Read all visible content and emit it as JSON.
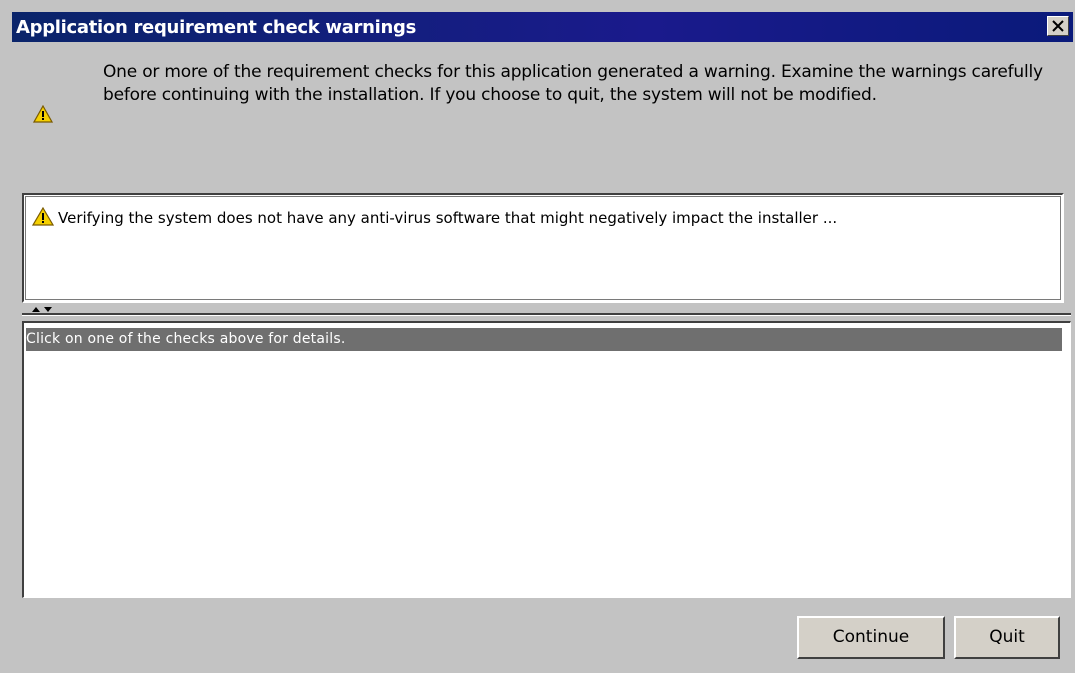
{
  "window": {
    "title": "Application requirement check warnings",
    "close_icon": "close-icon"
  },
  "header": {
    "message": "One or more of the requirement checks for this application generated a warning. Examine the warnings carefully before continuing with the installation. If you choose to quit, the system will not be modified.",
    "icon": "warning-icon"
  },
  "checks": [
    {
      "icon": "warning-icon",
      "label": "Verifying the system does not have any anti-virus software that might negatively impact the installer ..."
    }
  ],
  "details": {
    "header": "Click on one of the checks above for details."
  },
  "buttons": {
    "continue_label": "Continue",
    "quit_label": "Quit"
  },
  "colors": {
    "titlebar": "#0a246a",
    "warning_fill": "#f5d000",
    "details_header_bg": "#6f6f6f"
  }
}
